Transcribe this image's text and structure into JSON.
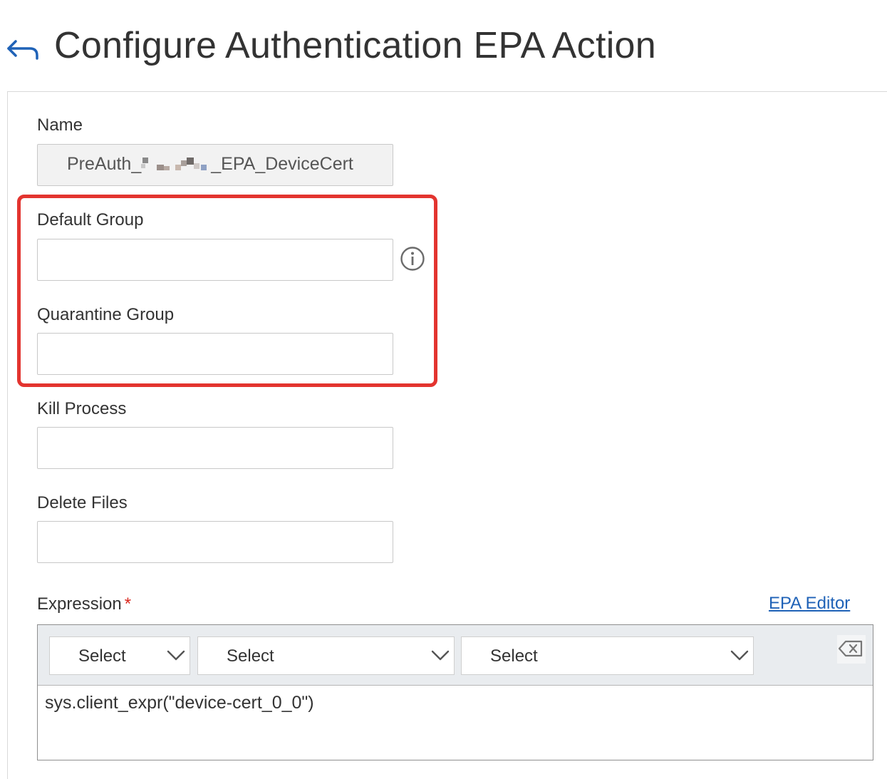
{
  "header": {
    "title": "Configure Authentication EPA Action",
    "back_icon": "back-arrow-icon"
  },
  "form": {
    "name": {
      "label": "Name",
      "value_prefix": "PreAuth_",
      "value_suffix": "_EPA_DeviceCert"
    },
    "default_group": {
      "label": "Default Group",
      "value": "",
      "info_icon": "info-icon"
    },
    "quarantine_group": {
      "label": "Quarantine Group",
      "value": ""
    },
    "kill_process": {
      "label": "Kill Process",
      "value": ""
    },
    "delete_files": {
      "label": "Delete Files",
      "value": ""
    },
    "expression": {
      "label": "Expression",
      "required_marker": "*",
      "editor_link": "EPA Editor",
      "selects": [
        "Select",
        "Select",
        "Select"
      ],
      "value": "sys.client_expr(\"device-cert_0_0\")",
      "clear_icon": "backspace-clear-icon"
    }
  },
  "colors": {
    "accent": "#1f62b7",
    "highlight": "#e3342f",
    "required": "#d9261c"
  }
}
